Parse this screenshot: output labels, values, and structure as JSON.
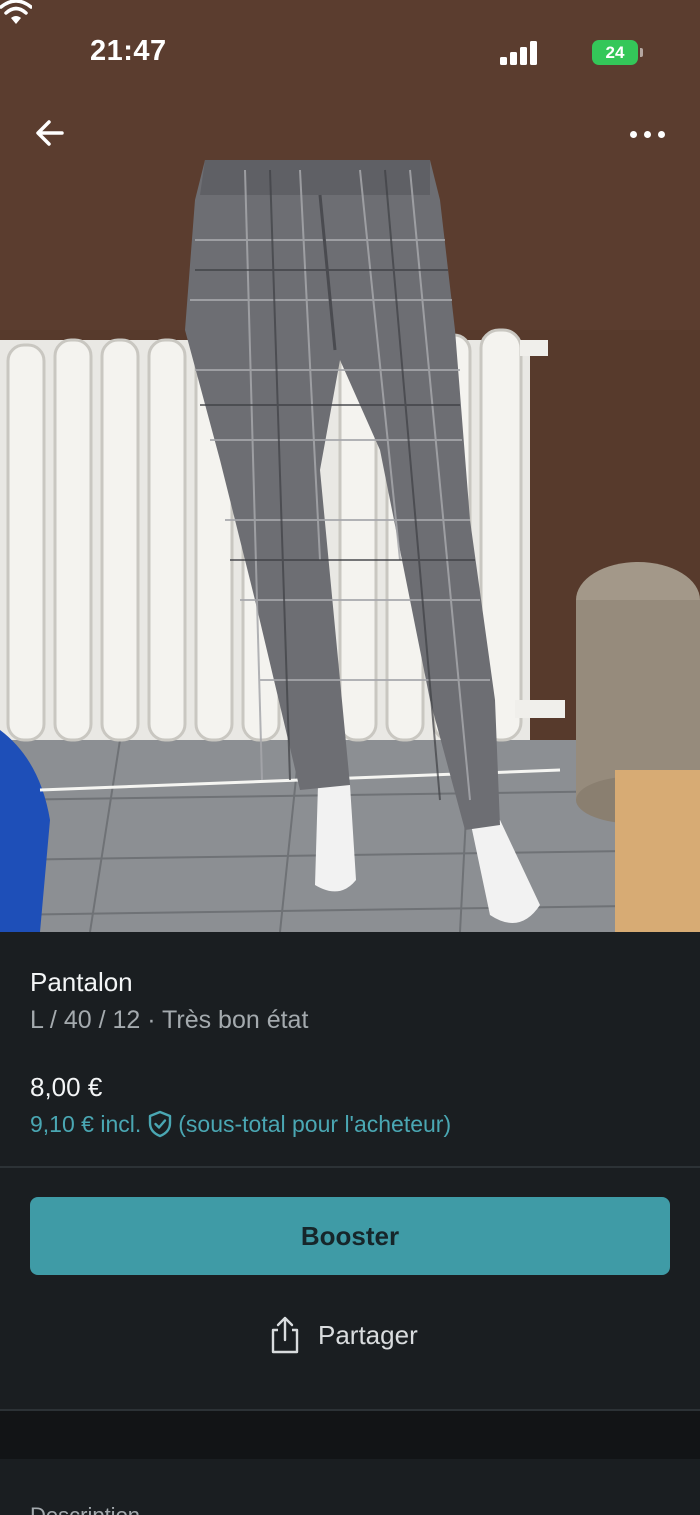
{
  "status_bar": {
    "time": "21:47",
    "battery_level": "24",
    "icons": [
      "signal-icon",
      "wifi-icon",
      "battery-charging-icon"
    ]
  },
  "photo": {
    "description_icons": [
      "back-arrow-icon",
      "more-options-icon"
    ]
  },
  "item": {
    "title": "Pantalon",
    "meta": "L / 40 / 12 · Très bon état",
    "price": "8,00 €",
    "buyer_price": "9,10 € incl.",
    "buyer_note": "(sous-total pour l'acheteur)"
  },
  "actions": {
    "boost_label": "Booster",
    "share_label": "Partager"
  },
  "description": {
    "heading": "Description"
  },
  "colors": {
    "accent": "#3f9ba6",
    "accent_text": "#4aa7b3",
    "panel": "#1a1e21",
    "background": "#121416"
  }
}
